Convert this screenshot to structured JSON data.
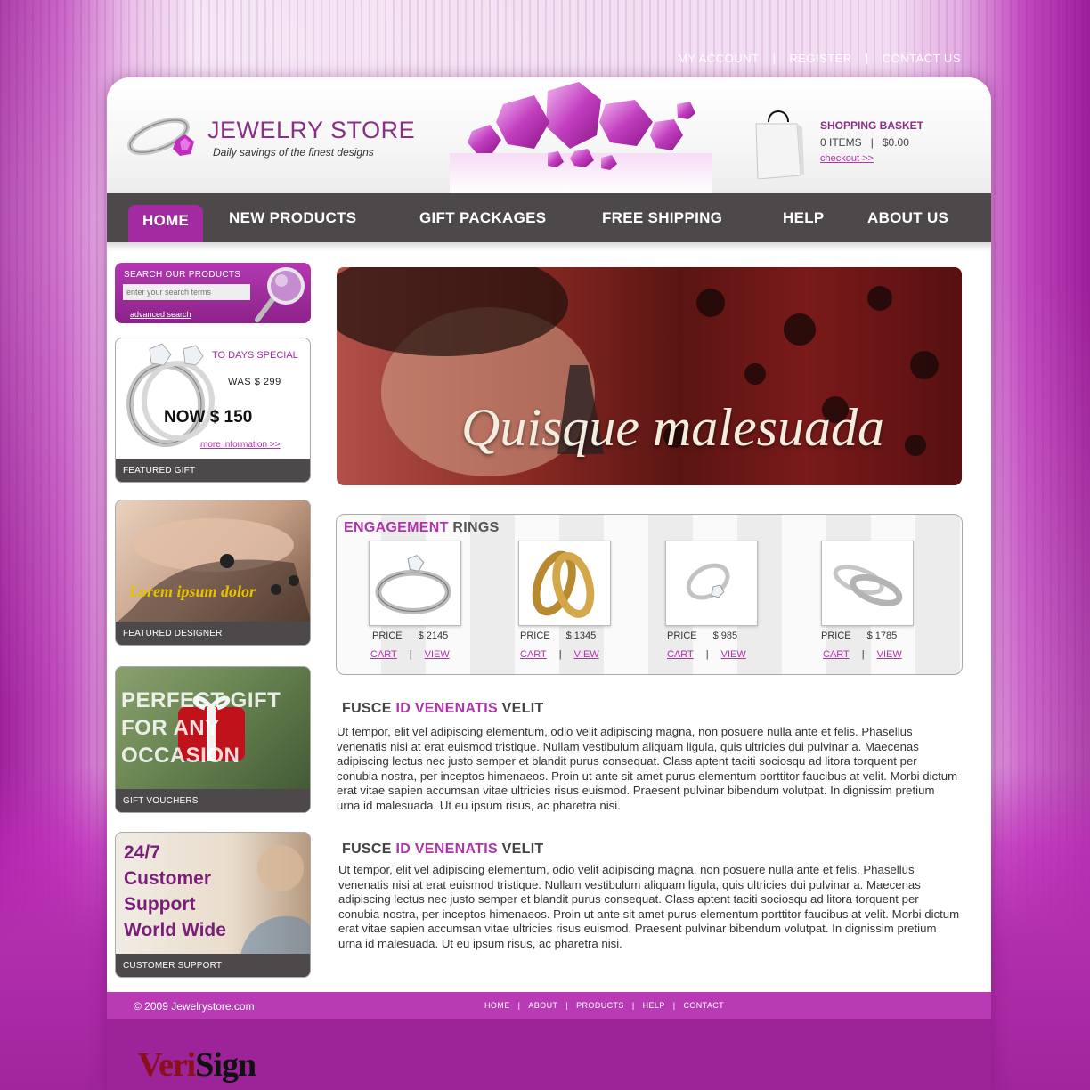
{
  "top_links": [
    "MY ACCOUNT",
    "|",
    "REGISTER",
    "|",
    "CONTACT US"
  ],
  "header": {
    "title": "JEWELRY STORE",
    "tagline": "Daily savings of the finest designs",
    "basket_title": "SHOPPING BASKET",
    "basket_items": "0 ITEMS",
    "basket_sep": "|",
    "basket_total": "$0.00",
    "checkout": "checkout >>"
  },
  "nav": [
    "HOME",
    "NEW PRODUCTS",
    "GIFT PACKAGES",
    "FREE SHIPPING",
    "HELP",
    "ABOUT US"
  ],
  "search": {
    "title": "SEARCH OUR PRODUCTS",
    "placeholder": "enter your search terms",
    "advanced": "advanced search"
  },
  "special": {
    "title": "TO DAYS SPECIAL",
    "was": "WAS $ 299",
    "now": "NOW $ 150",
    "more": "more information >>",
    "caption": "FEATURED GIFT"
  },
  "designer": {
    "text": "Lorem ipsum dolor",
    "caption": "FEATURED DESIGNER"
  },
  "gift": {
    "line1": "PERFECT GIFT",
    "line2": "FOR ANY",
    "line3": "OCCASION",
    "caption": "GIFT VOUCHERS"
  },
  "support": {
    "line1": "24/7",
    "line2": "Customer",
    "line3": "Support",
    "line4": "World Wide",
    "caption": "CUSTOMER SUPPORT"
  },
  "banner": {
    "text": "Quisque malesuada"
  },
  "rings": {
    "title_accent": "ENGAGEMENT",
    "title_rest": "RINGS",
    "price_label": "PRICE",
    "cart": "CART",
    "view": "VIEW",
    "sep": "|",
    "items": [
      {
        "price": "$ 2145"
      },
      {
        "price": "$ 1345"
      },
      {
        "price": "$ 985"
      },
      {
        "price": "$ 1785"
      }
    ]
  },
  "articles": [
    {
      "t1": "FUSCE",
      "t2": "ID VENENATIS",
      "t3": "VELIT",
      "body": "Ut tempor, elit vel adipiscing elementum, odio velit adipiscing magna, non posuere nulla ante et felis. Phasellus venenatis nisi at erat euismod tristique. Nullam vestibulum aliquam ligula, quis ultricies dui pulvinar a. Maecenas adipiscing lectus nec justo semper et blandit purus consequat. Class aptent taciti sociosqu ad litora torquent per conubia nostra, per inceptos himenaeos. Proin ut ante sit amet purus elementum porttitor faucibus at velit. Morbi dictum erat vitae sapien accumsan vitae ultricies risus euismod. Praesent pulvinar bibendum volutpat. In dignissim pretium urna id malesuada. Ut eu ipsum risus, ac pharetra nisi."
    },
    {
      "t1": "FUSCE",
      "t2": "ID VENENATIS",
      "t3": "VELIT",
      "body": "Ut tempor, elit vel adipiscing elementum, odio velit adipiscing magna, non posuere nulla ante et felis. Phasellus venenatis nisi at erat euismod tristique. Nullam vestibulum aliquam ligula, quis ultricies dui pulvinar a. Maecenas adipiscing lectus nec justo semper et blandit purus consequat. Class aptent taciti sociosqu ad litora torquent per conubia nostra, per inceptos himenaeos. Proin ut ante sit amet purus elementum porttitor faucibus at velit. Morbi dictum erat vitae sapien accumsan vitae ultricies risus euismod. Praesent pulvinar bibendum volutpat. In dignissim pretium urna id malesuada. Ut eu ipsum risus, ac pharetra nisi."
    }
  ],
  "footer": {
    "copyright": "© 2009 Jewelrystore.com",
    "links": [
      "HOME",
      "|",
      "ABOUT",
      "|",
      "PRODUCTS",
      "|",
      "HELP",
      "|",
      "CONTACT"
    ],
    "verisign_1": "Veri",
    "verisign_2": "Sign"
  },
  "colors": {
    "accent": "#a32aa0",
    "nav_bg": "#4d4849",
    "link": "#b033ac"
  }
}
